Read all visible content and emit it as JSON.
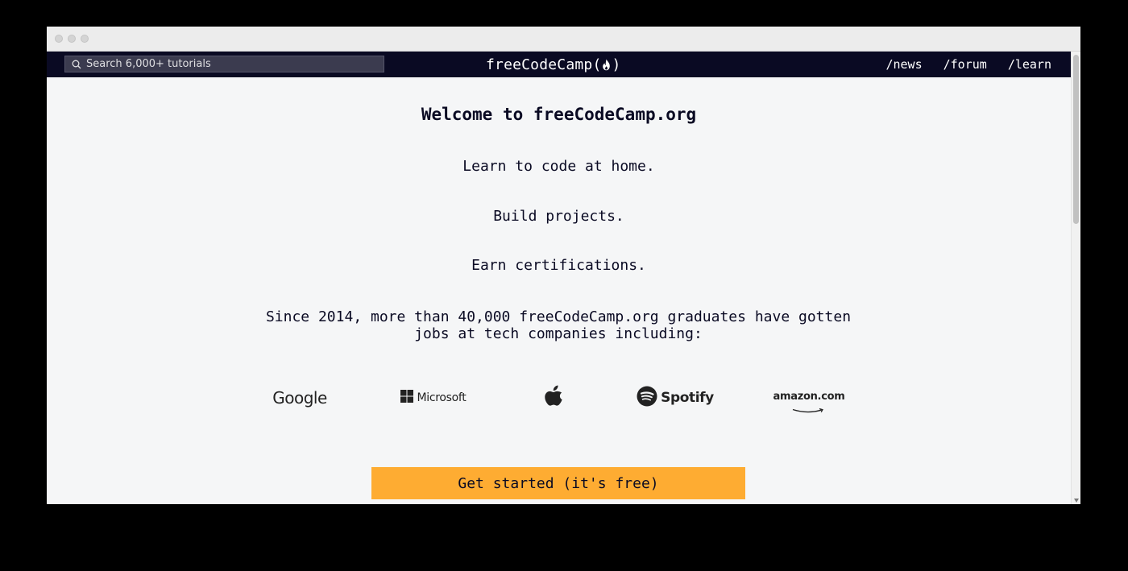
{
  "search": {
    "placeholder": "Search 6,000+ tutorials"
  },
  "header": {
    "brand_left": "freeCodeCamp(",
    "brand_right": ")",
    "nav_links": [
      "/news",
      "/forum",
      "/learn"
    ]
  },
  "main": {
    "headline": "Welcome to freeCodeCamp.org",
    "lines": [
      "Learn to code at home.",
      "Build projects.",
      "Earn certifications."
    ],
    "since_line1": "Since 2014, more than 40,000 freeCodeCamp.org graduates have gotten",
    "since_line2": "jobs at tech companies including:",
    "logos": {
      "google": "Google",
      "microsoft": "Microsoft",
      "spotify": "Spotify",
      "amazon": "amazon.com"
    },
    "cta_label": "Get started (it's free)"
  },
  "colors": {
    "navbar": "#0a0a23",
    "page_bg": "#f5f6f7",
    "cta_bg": "#feac32",
    "text": "#0a0a23"
  },
  "icons": [
    "search-icon",
    "flame-icon",
    "microsoft-logo-icon",
    "apple-logo-icon",
    "spotify-logo-icon",
    "amazon-smile-icon"
  ]
}
